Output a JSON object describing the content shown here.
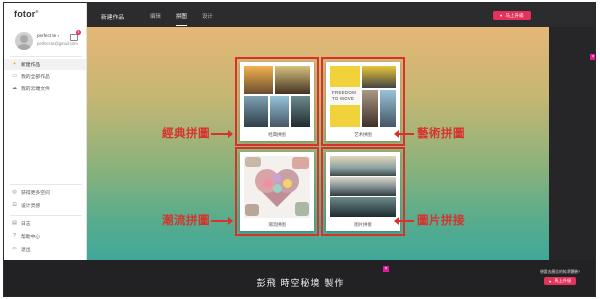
{
  "app": {
    "logo": "fotor",
    "logo_mark": "®"
  },
  "user": {
    "name": "perfect te",
    "caret": "▾",
    "email": "perfect.te@gmail.com",
    "badge": "4"
  },
  "sidebar": {
    "items": [
      {
        "icon": "+",
        "label": "新建作品"
      },
      {
        "icon": "▭",
        "label": "我的全部作品"
      },
      {
        "icon": "☁",
        "label": "我的云端文件"
      }
    ],
    "bottom_items": [
      {
        "icon": "◎",
        "label": "获得更多空间"
      },
      {
        "icon": "⊡",
        "label": "设计灵感"
      }
    ],
    "footer_items": [
      {
        "icon": "▤",
        "label": "日志"
      },
      {
        "icon": "?",
        "label": "帮助中心"
      },
      {
        "icon": "⇦",
        "label": "退出"
      }
    ]
  },
  "topbar": {
    "title": "新建作品",
    "tabs": [
      "编辑",
      "拼图",
      "设计"
    ],
    "upgrade_label": "马上升级",
    "upgrade_icon": "♥"
  },
  "cards": [
    {
      "label": "经典拼图"
    },
    {
      "label": "艺术拼图",
      "text": "FREEDOM\nTO MOVE"
    },
    {
      "label": "潮流拼图"
    },
    {
      "label": "图片拼接"
    }
  ],
  "annotations": {
    "classic": "經典拼圖",
    "art": "藝術拼圖",
    "trend": "潮流拼圖",
    "stitch": "圖片拼接"
  },
  "bottom": {
    "credit": "彭飛 時空秘境 製作",
    "promo_text": "想要去廣告的純凈體驗?",
    "upgrade_label": "馬上升級",
    "close_icon": "×"
  },
  "colors": {
    "accent": "#e6315b",
    "annotation_red": "#d8322d",
    "topbar": "#2c2c2e",
    "bottombar": "#222224"
  }
}
